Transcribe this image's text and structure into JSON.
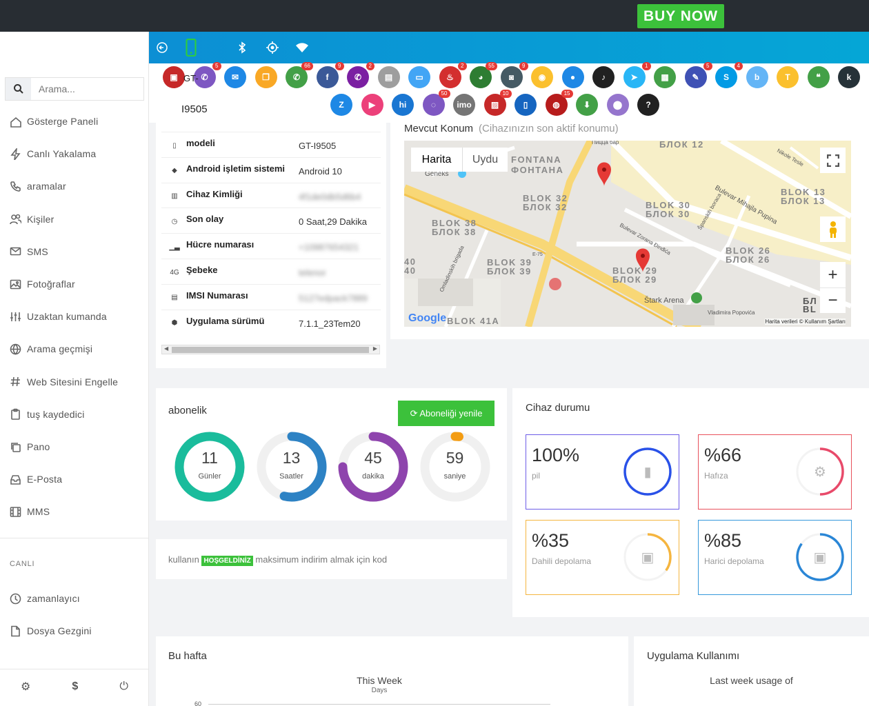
{
  "topbar": {
    "buy_label": "BUY NOW"
  },
  "search": {
    "placeholder": "Arama..."
  },
  "nav": [
    {
      "label": "Gösterge Paneli",
      "icon": "home-icon"
    },
    {
      "label": "Canlı Yakalama",
      "icon": "bolt-icon"
    },
    {
      "label": "aramalar",
      "icon": "phone-icon"
    },
    {
      "label": "Kişiler",
      "icon": "users-icon"
    },
    {
      "label": "SMS",
      "icon": "mail-icon"
    },
    {
      "label": "Fotoğraflar",
      "icon": "image-icon"
    },
    {
      "label": "Uzaktan kumanda",
      "icon": "sliders-icon"
    },
    {
      "label": "Arama geçmişi",
      "icon": "globe-icon"
    },
    {
      "label": "Web Sitesini Engelle",
      "icon": "hash-icon"
    },
    {
      "label": "tuş kaydedici",
      "icon": "clipboard-icon"
    },
    {
      "label": "Pano",
      "icon": "copy-icon"
    },
    {
      "label": "E-Posta",
      "icon": "inbox-icon"
    },
    {
      "label": "MMS",
      "icon": "film-icon"
    }
  ],
  "section_live": "CANLI",
  "nav_live": [
    {
      "label": "zamanlayıcı",
      "icon": "clock-icon"
    },
    {
      "label": "Dosya Gezgini",
      "icon": "file-icon"
    }
  ],
  "footer": {
    "settings": "⚙",
    "dollar": "$",
    "power": "⏻"
  },
  "device": {
    "prefix": "GT-",
    "name": "I9505"
  },
  "apps": [
    {
      "name": "record",
      "color": "#c62828",
      "glyph": "▣",
      "badge": ""
    },
    {
      "name": "phone",
      "color": "#7e57c2",
      "glyph": "✆",
      "badge": "5"
    },
    {
      "name": "email",
      "color": "#1e88e5",
      "glyph": "✉",
      "badge": ""
    },
    {
      "name": "clipboard",
      "color": "#f9a825",
      "glyph": "❐",
      "badge": ""
    },
    {
      "name": "whatsapp",
      "color": "#43a047",
      "glyph": "✆",
      "badge": "66"
    },
    {
      "name": "facebook",
      "color": "#3b5998",
      "glyph": "f",
      "badge": "9"
    },
    {
      "name": "viber",
      "color": "#7b1fa2",
      "glyph": "✆",
      "badge": "2"
    },
    {
      "name": "keylogger",
      "color": "#9e9e9e",
      "glyph": "▤",
      "badge": ""
    },
    {
      "name": "screen",
      "color": "#42a5f5",
      "glyph": "▭",
      "badge": ""
    },
    {
      "name": "tinder",
      "color": "#d32f2f",
      "glyph": "♨",
      "badge": "2"
    },
    {
      "name": "wechat",
      "color": "#2e7d32",
      "glyph": "◕",
      "badge": "55"
    },
    {
      "name": "instagram",
      "color": "#455a64",
      "glyph": "◙",
      "badge": "9"
    },
    {
      "name": "snapchat",
      "color": "#fbc02d",
      "glyph": "◉",
      "badge": ""
    },
    {
      "name": "flickr",
      "color": "#1e88e5",
      "glyph": "●",
      "badge": ""
    },
    {
      "name": "tiktok",
      "color": "#212121",
      "glyph": "♪",
      "badge": ""
    },
    {
      "name": "telegram",
      "color": "#29b6f6",
      "glyph": "➤",
      "badge": "1"
    },
    {
      "name": "line",
      "color": "#43a047",
      "glyph": "▦",
      "badge": ""
    },
    {
      "name": "messenger",
      "color": "#3f51b5",
      "glyph": "✎",
      "badge": "5"
    },
    {
      "name": "skype",
      "color": "#039be5",
      "glyph": "S",
      "badge": "4"
    },
    {
      "name": "bip",
      "color": "#64b5f6",
      "glyph": "b",
      "badge": ""
    },
    {
      "name": "kakaotalk",
      "color": "#fbc02d",
      "glyph": "T",
      "badge": ""
    },
    {
      "name": "hangouts",
      "color": "#43a047",
      "glyph": "❝",
      "badge": ""
    },
    {
      "name": "kik",
      "color": "#263238",
      "glyph": "k",
      "badge": ""
    },
    {
      "name": "zalo",
      "color": "#1e88e5",
      "glyph": "Z",
      "badge": ""
    },
    {
      "name": "imo-video",
      "color": "#ec407a",
      "glyph": "▶",
      "badge": ""
    },
    {
      "name": "hike",
      "color": "#1976d2",
      "glyph": "hi",
      "badge": ""
    },
    {
      "name": "signal",
      "color": "#7e57c2",
      "glyph": "◌",
      "badge": "50"
    },
    {
      "name": "imo",
      "color": "#757575",
      "glyph": "imo",
      "badge": ""
    },
    {
      "name": "gallery",
      "color": "#c62828",
      "glyph": "▨",
      "badge": "10"
    },
    {
      "name": "device",
      "color": "#1565c0",
      "glyph": "▯",
      "badge": ""
    },
    {
      "name": "web",
      "color": "#b71c1c",
      "glyph": "◍",
      "badge": "15"
    },
    {
      "name": "download",
      "color": "#43a047",
      "glyph": "⬇",
      "badge": ""
    },
    {
      "name": "location",
      "color": "#9575cd",
      "glyph": "⬤",
      "badge": ""
    },
    {
      "name": "help",
      "color": "#212121",
      "glyph": "?",
      "badge": ""
    }
  ],
  "info": [
    {
      "label": "modeli",
      "value": "GT-I9505",
      "icon": "phone-icon",
      "blur": false
    },
    {
      "label": "Android işletim sistemi",
      "value": "Android 10",
      "icon": "android-icon",
      "blur": false
    },
    {
      "label": "Cihaz Kimliği",
      "value": "4f1de0db5d6b4",
      "icon": "barcode-icon",
      "blur": true
    },
    {
      "label": "Son olay",
      "value": "0 Saat,29 Dakika",
      "icon": "clock-icon",
      "blur": false
    },
    {
      "label": "Hücre numarası",
      "value": "+10987654321",
      "icon": "signal-icon",
      "blur": true
    },
    {
      "label": "Şebeke",
      "value": "telenor",
      "icon": "network-icon",
      "blur": true
    },
    {
      "label": "IMSI Numarası",
      "value": "5127edpack7889",
      "icon": "sim-icon",
      "blur": true
    },
    {
      "label": "Uygulama sürümü",
      "value": "7.1.1_23Tem20",
      "icon": "shield-icon",
      "blur": false
    }
  ],
  "map": {
    "title": "Mevcut Konum",
    "subtitle": "(Cihazınızın son aktif konumu)",
    "tab_map": "Harita",
    "tab_sat": "Uydu",
    "labels": [
      {
        "text": "БЛОК 12"
      },
      {
        "text": "FONTANA"
      },
      {
        "text": "ФОНТАНА"
      },
      {
        "text": "BLOK 32"
      },
      {
        "text": "БЛОК 32"
      },
      {
        "text": "BLOK 30"
      },
      {
        "text": "БЛОК 30"
      },
      {
        "text": "BLOK 13"
      },
      {
        "text": "БЛОК 13"
      },
      {
        "text": "BLOK 38"
      },
      {
        "text": "БЛОК 38"
      },
      {
        "text": "BLOK 39"
      },
      {
        "text": "БЛОК 39"
      },
      {
        "text": "BLOK 29"
      },
      {
        "text": "БЛОК 29"
      },
      {
        "text": "BLOK 26"
      },
      {
        "text": "БЛОК 26"
      },
      {
        "text": "BLOK 41A"
      },
      {
        "text": "40"
      },
      {
        "text": "40"
      },
      {
        "text": "Geneks"
      },
      {
        "text": "Štark Arena"
      },
      {
        "text": "Bulevar Mihajla Pupina"
      },
      {
        "text": "Bulevar Zorana Đinđića"
      },
      {
        "text": "Španskih boraca"
      },
      {
        "text": "Omladinskih brigada"
      },
      {
        "text": "Vladimira Popovića"
      },
      {
        "text": "Nikole Tesle"
      },
      {
        "text": "E-75"
      },
      {
        "text": "Пицца бар"
      },
      {
        "text": "БЛ"
      },
      {
        "text": "BL"
      }
    ],
    "google": "Google",
    "attribution": "Harita verileri ©  Kullanım Şartları"
  },
  "subscription": {
    "title": "abonelik",
    "renew_label": "Aboneliği yenile",
    "rings": [
      {
        "value": "11",
        "unit": "Günler",
        "color": "#1abc9c",
        "fraction": 1.0
      },
      {
        "value": "13",
        "unit": "Saatler",
        "color": "#2d82c4",
        "fraction": 0.54
      },
      {
        "value": "45",
        "unit": "dakika",
        "color": "#8e44ad",
        "fraction": 0.75
      },
      {
        "value": "59",
        "unit": "saniye",
        "color": "#f39c12",
        "fraction": 0.02
      }
    ]
  },
  "promo": {
    "prefix": "kullanın",
    "code": "HOŞGELDİNİZ",
    "suffix": "maksimum indirim almak için kod"
  },
  "device_status": {
    "title": "Cihaz durumu",
    "stats": [
      {
        "value": "100%",
        "label": "pil",
        "color": "#6c5ce7",
        "ring": "#2951e8",
        "fraction": 1.0,
        "icon": "battery-icon",
        "glyph": "▮"
      },
      {
        "value": "%66",
        "label": "Hafıza",
        "color": "#e8505b",
        "ring": "#e84a6a",
        "fraction": 0.5,
        "icon": "chip-icon",
        "glyph": "⚙"
      },
      {
        "value": "%35",
        "label": "Dahili depolama",
        "color": "#f5b53f",
        "ring": "#f5b53f",
        "fraction": 0.35,
        "icon": "save-icon",
        "glyph": "▣"
      },
      {
        "value": "%85",
        "label": "Harici depolama",
        "color": "#3498db",
        "ring": "#2a86d6",
        "fraction": 0.85,
        "icon": "save-icon",
        "glyph": "▣"
      }
    ]
  },
  "week": {
    "title": "Bu hafta",
    "chart_title": "This Week",
    "chart_sub": "Days",
    "ytick": "60"
  },
  "usage": {
    "title": "Uygulama Kullanımı",
    "sub": "Last week usage of"
  }
}
